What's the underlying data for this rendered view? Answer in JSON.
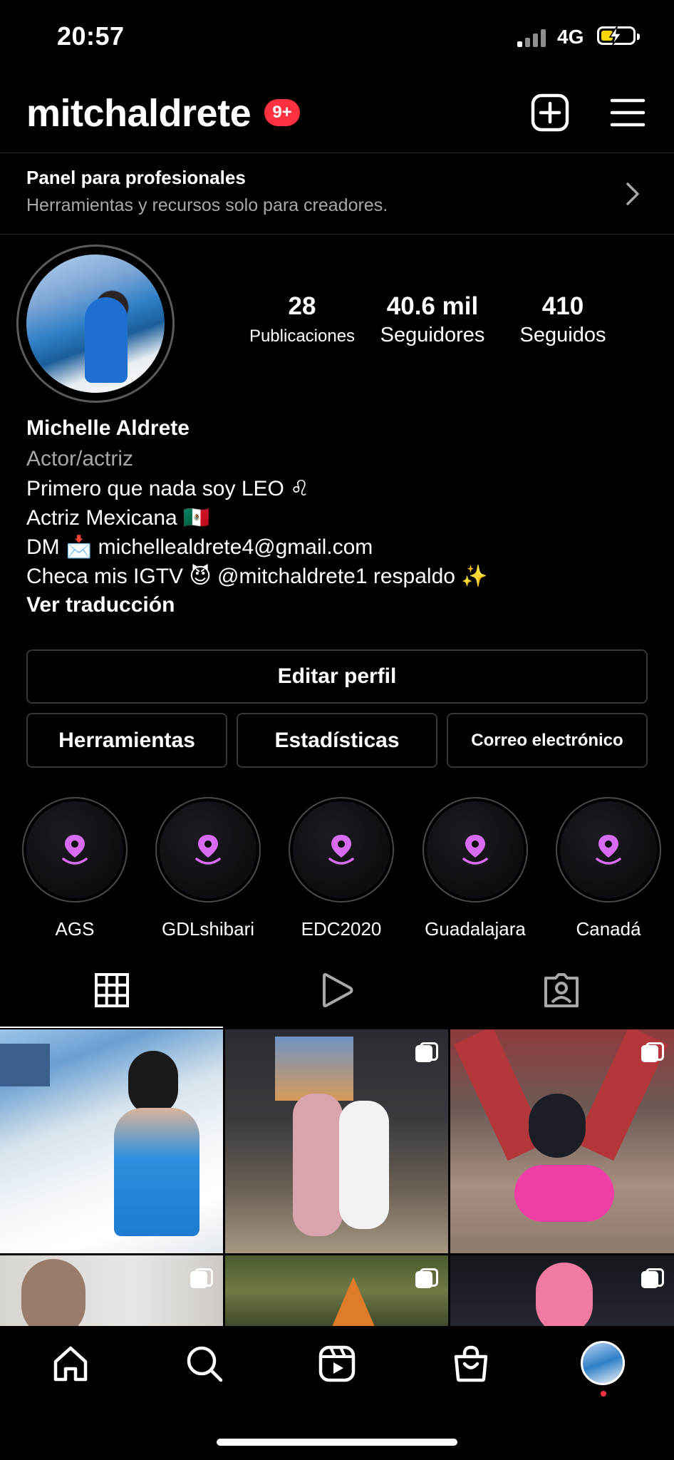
{
  "status_bar": {
    "time": "20:57",
    "network": "4G"
  },
  "header": {
    "username": "mitchaldrete",
    "notification_badge": "9+"
  },
  "pro_panel": {
    "title": "Panel para profesionales",
    "subtitle": "Herramientas y recursos solo para creadores."
  },
  "stats": [
    {
      "value": "28",
      "label": "Publicaciones"
    },
    {
      "value": "40.6 mil",
      "label": "Seguidores"
    },
    {
      "value": "410",
      "label": "Seguidos"
    }
  ],
  "bio": {
    "name": "Michelle Aldrete",
    "category": "Actor/actriz",
    "lines": [
      "Primero que nada soy LEO ♌",
      "Actriz Mexicana 🇲🇽",
      "DM 📩 michellealdrete4@gmail.com",
      "Checa mis IGTV 😈 @mitchaldrete1 respaldo ✨"
    ],
    "translate_link": "Ver traducción"
  },
  "buttons": {
    "edit_profile": "Editar perfil",
    "tools": "Herramientas",
    "insights": "Estadísticas",
    "email": "Correo electrónico"
  },
  "highlights": [
    {
      "label": "AGS"
    },
    {
      "label": "GDLshibari"
    },
    {
      "label": "EDC2020"
    },
    {
      "label": "Guadalajara"
    },
    {
      "label": "Canadá"
    }
  ],
  "tabs": {
    "active": "grid",
    "items": [
      "grid-icon",
      "reels-play-icon",
      "tagged-icon"
    ]
  },
  "colors": {
    "badge": "#ff3040",
    "highlight_pin": "#d86cf0",
    "muted_text": "#a8a8a8",
    "border": "#363636"
  }
}
